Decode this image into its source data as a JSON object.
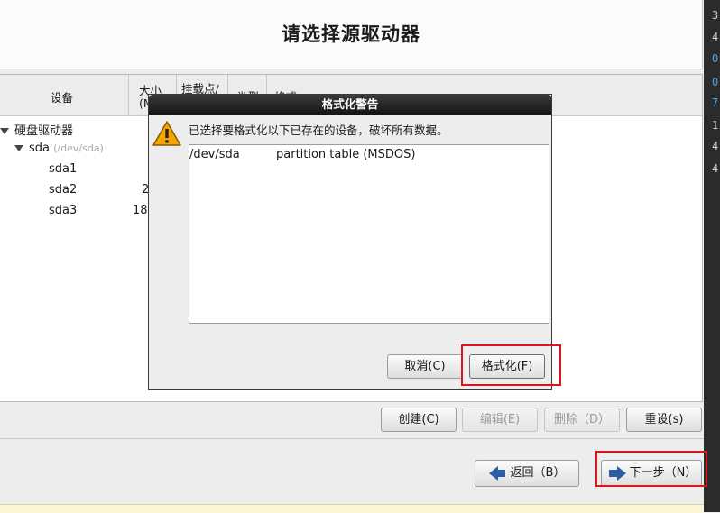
{
  "page": {
    "title": "请选择源驱动器"
  },
  "right_strip": {
    "chars": [
      "3",
      "4",
      "0",
      "0",
      "7",
      "1",
      "4",
      "4"
    ]
  },
  "table": {
    "headers": {
      "device": "设备",
      "size_line1": "大小",
      "size_line2": "(M",
      "mount_line1": "挂载点/",
      "mount_line2": "R",
      "type_fragment": "类型",
      "format_fragment": "格式"
    },
    "tree": {
      "group_label": "硬盘驱动器",
      "disk_name": "sda",
      "disk_path": "(/dev/sda)",
      "partitions": [
        {
          "name": "sda1",
          "size": ""
        },
        {
          "name": "sda2",
          "size": "2"
        },
        {
          "name": "sda3",
          "size": "18"
        }
      ]
    }
  },
  "panel_buttons": {
    "create": "创建(C)",
    "edit": "编辑(E)",
    "delete": "删除（D）",
    "reset": "重设(s)"
  },
  "nav": {
    "back": "返回（B）",
    "next": "下一步（N）"
  },
  "dialog": {
    "title": "格式化警告",
    "message": "已选择要格式化以下已存在的设备，破坏所有数据。",
    "devices": [
      {
        "device": "/dev/sda",
        "description": "partition table (MSDOS)"
      }
    ],
    "cancel_label": "取消(C)",
    "format_label": "格式化(F)"
  },
  "colors": {
    "highlight": "#e0141c",
    "accent_blue": "#2a5fa5",
    "warning_yellow": "#f5a400"
  }
}
